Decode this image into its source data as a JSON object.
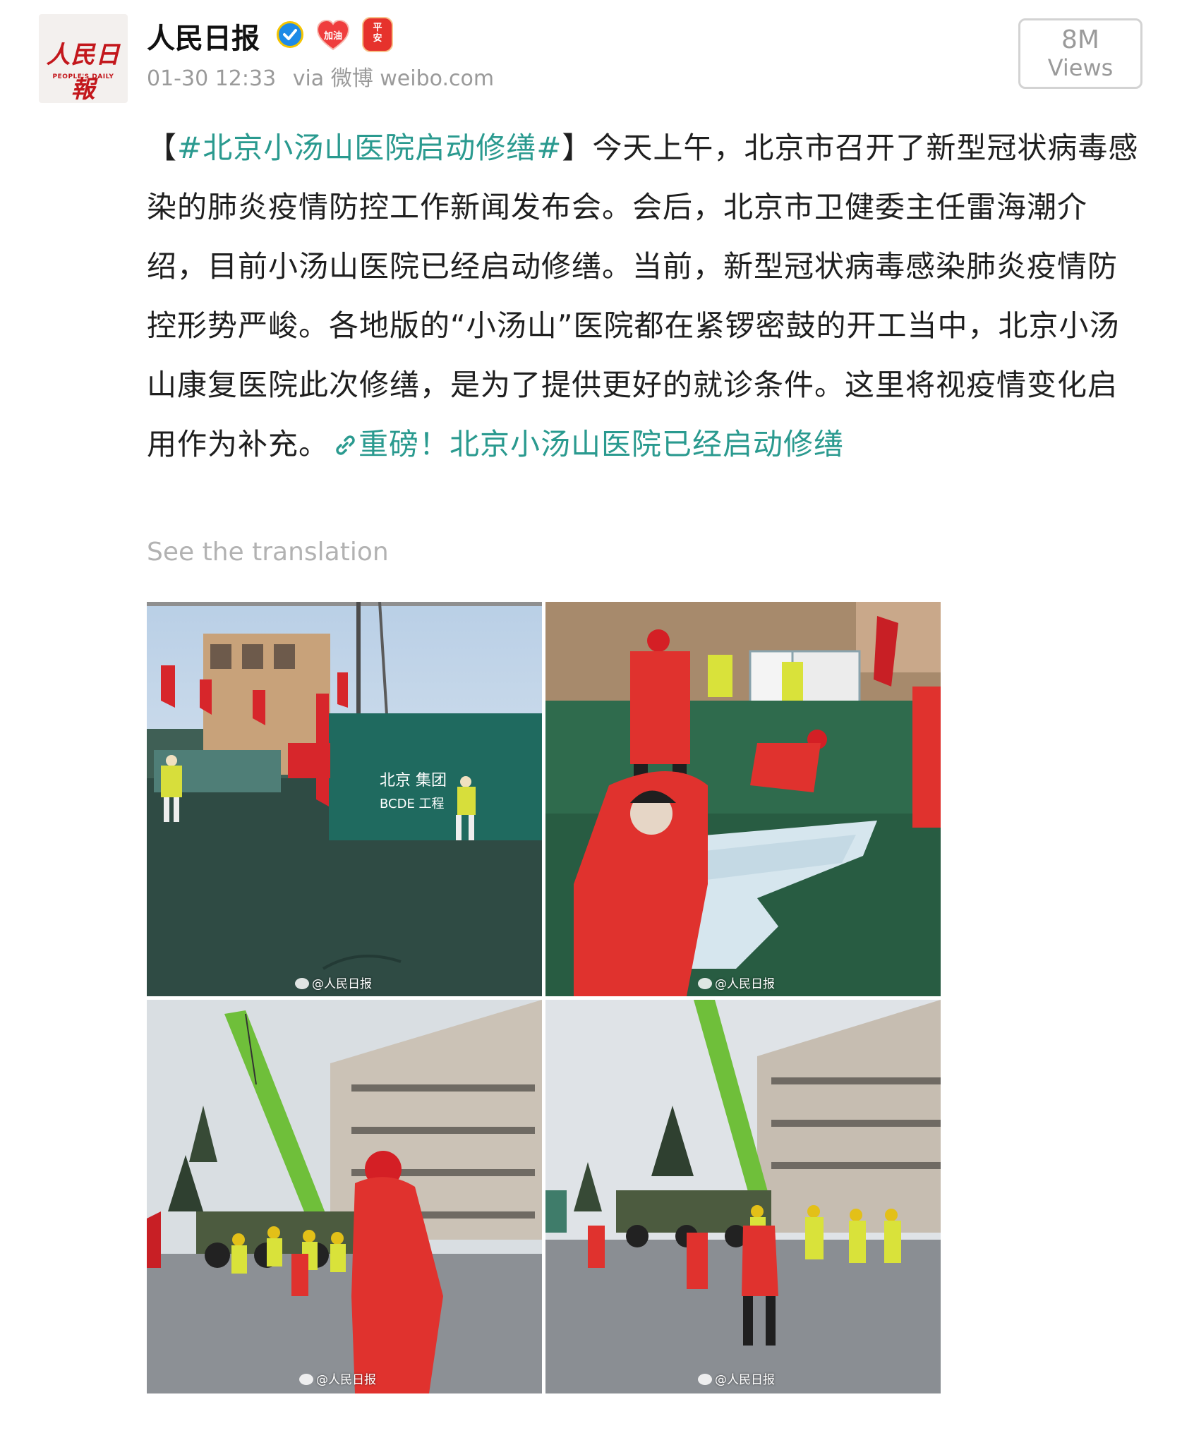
{
  "post": {
    "author": {
      "name": "人民日报",
      "avatar_logo": "人民日報",
      "avatar_subtitle": "PEOPLE'S DAILY",
      "verified_icon": "verified-check-icon",
      "badge_heart": "加油",
      "badge_peace": "平\n安"
    },
    "meta": {
      "timestamp": "01-30 12:33",
      "via": "via 微博 weibo.com"
    },
    "views": {
      "count": "8M",
      "label": "Views"
    },
    "content": {
      "bracket_open": "【",
      "hashtag": "#北京小汤山医院启动修缮#",
      "bracket_close": "】",
      "body": "今天上午，北京市召开了新型冠状病毒感染的肺炎疫情防控工作新闻发布会。会后，北京市卫健委主任雷海潮介绍，目前小汤山医院已经启动修缮。当前，新型冠状病毒感染肺炎疫情防控形势严峻。各地版的“小汤山”医院都在紧锣密鼓的开工当中，北京小汤山康复医院此次修缮，是为了提供更好的就诊条件。这里将视疫情变化启用作为补充。",
      "link_icon": "link-icon",
      "link_text": "重磅！北京小汤山医院已经启动修缮"
    },
    "translate_label": "See the translation",
    "images": [
      {
        "watermark": "@人民日报"
      },
      {
        "watermark": "@人民日报"
      },
      {
        "watermark": "@人民日报"
      },
      {
        "watermark": "@人民日报"
      }
    ]
  },
  "colors": {
    "link": "#2a9a8f",
    "meta": "#9a9a9a",
    "verified": "#1e8ae6",
    "brand_red": "#c3171c"
  }
}
